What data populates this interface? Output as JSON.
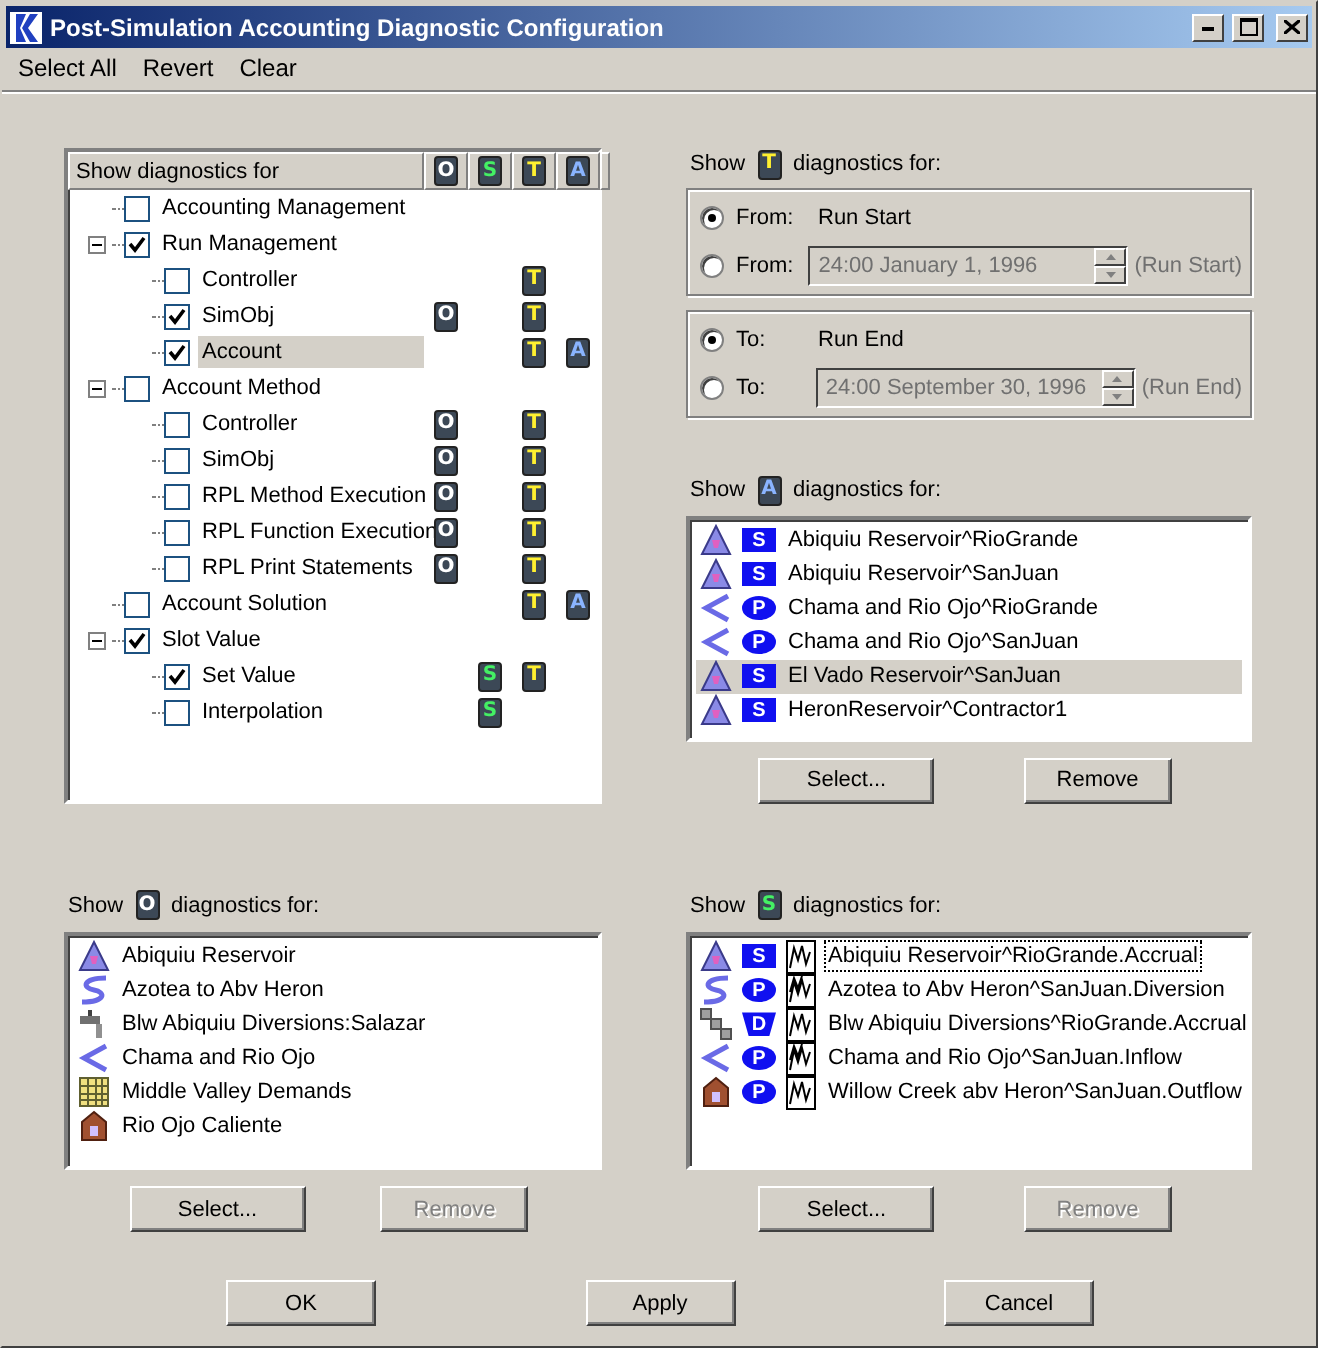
{
  "window": {
    "title": "Post-Simulation Accounting Diagnostic Configuration"
  },
  "menu": [
    {
      "label": "Select All"
    },
    {
      "label": "Revert"
    },
    {
      "label": "Clear"
    }
  ],
  "tree": {
    "heading": "Show diagnostics for",
    "columns": [
      {
        "kind": "object",
        "letter": "O"
      },
      {
        "kind": "slot",
        "letter": "S"
      },
      {
        "kind": "time",
        "letter": "T"
      },
      {
        "kind": "account",
        "letter": "A"
      }
    ],
    "items": [
      {
        "label": "Accounting Management",
        "checked": false,
        "selected": false
      },
      {
        "label": "Run Management",
        "checked": true,
        "selected": false,
        "expanded": true,
        "children": [
          {
            "label": "Controller",
            "checked": false,
            "selected": false,
            "badges": [
              {
                "kind": "time",
                "letter": "T"
              }
            ]
          },
          {
            "label": "SimObj",
            "checked": true,
            "selected": false,
            "badges": [
              {
                "kind": "object",
                "letter": "O"
              },
              {
                "kind": "time",
                "letter": "T"
              }
            ]
          },
          {
            "label": "Account",
            "checked": true,
            "selected": true,
            "badges": [
              {
                "kind": "time",
                "letter": "T"
              },
              {
                "kind": "account",
                "letter": "A"
              }
            ]
          }
        ]
      },
      {
        "label": "Account Method",
        "checked": false,
        "selected": false,
        "expanded": true,
        "children": [
          {
            "label": "Controller",
            "checked": false,
            "selected": false,
            "badges": [
              {
                "kind": "object",
                "letter": "O"
              },
              {
                "kind": "time",
                "letter": "T"
              }
            ]
          },
          {
            "label": "SimObj",
            "checked": false,
            "selected": false,
            "badges": [
              {
                "kind": "object",
                "letter": "O"
              },
              {
                "kind": "time",
                "letter": "T"
              }
            ]
          },
          {
            "label": "RPL Method Execution",
            "checked": false,
            "selected": false,
            "badges": [
              {
                "kind": "object",
                "letter": "O"
              },
              {
                "kind": "time",
                "letter": "T"
              }
            ]
          },
          {
            "label": "RPL Function Execution",
            "checked": false,
            "selected": false,
            "badges": [
              {
                "kind": "object",
                "letter": "O"
              },
              {
                "kind": "time",
                "letter": "T"
              }
            ]
          },
          {
            "label": "RPL Print Statements",
            "checked": false,
            "selected": false,
            "badges": [
              {
                "kind": "object",
                "letter": "O"
              },
              {
                "kind": "time",
                "letter": "T"
              }
            ]
          }
        ]
      },
      {
        "label": "Account Solution",
        "checked": false,
        "selected": false,
        "badges": [
          {
            "kind": "time",
            "letter": "T"
          },
          {
            "kind": "account",
            "letter": "A"
          }
        ]
      },
      {
        "label": "Slot Value",
        "checked": true,
        "selected": false,
        "expanded": true,
        "children": [
          {
            "label": "Set Value",
            "checked": true,
            "selected": false,
            "badges": [
              {
                "kind": "slot",
                "letter": "S"
              },
              {
                "kind": "time",
                "letter": "T"
              }
            ]
          },
          {
            "label": "Interpolation",
            "checked": false,
            "selected": false,
            "badges": [
              {
                "kind": "slot",
                "letter": "S"
              }
            ]
          }
        ]
      }
    ]
  },
  "time": {
    "prefix": "Show",
    "badge": {
      "kind": "time",
      "letter": "T"
    },
    "suffix": "diagnostics for:",
    "groups": [
      {
        "options": [
          {
            "label": "From:",
            "kind": "preset",
            "value": "Run Start",
            "selected": true
          },
          {
            "label": "From:",
            "kind": "date",
            "value": "24:00 January 1, 1996",
            "note": "(Run Start)",
            "selected": false
          }
        ]
      },
      {
        "options": [
          {
            "label": "To:",
            "kind": "preset",
            "value": "Run End",
            "selected": true
          },
          {
            "label": "To:",
            "kind": "date",
            "value": "24:00 September 30, 1996",
            "note": "(Run End)",
            "selected": false
          }
        ]
      }
    ]
  },
  "accounts": {
    "prefix": "Show",
    "badge": {
      "kind": "account",
      "letter": "A"
    },
    "suffix": "diagnostics for:",
    "items": [
      {
        "kind": "reservoir",
        "type": {
          "kind": "square",
          "letter": "S"
        },
        "label": "Abiquiu Reservoir^RioGrande",
        "selected": false
      },
      {
        "kind": "reservoir",
        "type": {
          "kind": "square",
          "letter": "S"
        },
        "label": "Abiquiu Reservoir^SanJuan",
        "selected": false
      },
      {
        "kind": "reach",
        "type": {
          "kind": "oval",
          "letter": "P"
        },
        "label": "Chama and Rio Ojo^RioGrande",
        "selected": false
      },
      {
        "kind": "reach",
        "type": {
          "kind": "oval",
          "letter": "P"
        },
        "label": "Chama and Rio Ojo^SanJuan",
        "selected": false
      },
      {
        "kind": "reservoir",
        "type": {
          "kind": "square",
          "letter": "S"
        },
        "label": "El Vado Reservoir^SanJuan",
        "selected": true
      },
      {
        "kind": "reservoir",
        "type": {
          "kind": "square",
          "letter": "S"
        },
        "label": "HeronReservoir^Contractor1",
        "selected": false
      }
    ],
    "buttons": [
      {
        "label": "Select...",
        "disabled": false
      },
      {
        "label": "Remove",
        "disabled": false
      }
    ]
  },
  "objects": {
    "prefix": "Show",
    "badge": {
      "kind": "object",
      "letter": "O"
    },
    "suffix": "diagnostics for:",
    "items": [
      {
        "kind": "reservoir",
        "label": "Abiquiu Reservoir",
        "selected": false
      },
      {
        "kind": "canal",
        "label": "Azotea to Abv Heron",
        "selected": false
      },
      {
        "kind": "diversion",
        "label": "Blw Abiquiu Diversions:Salazar",
        "selected": false
      },
      {
        "kind": "reach",
        "label": "Chama and Rio Ojo",
        "selected": false
      },
      {
        "kind": "demand",
        "label": "Middle Valley Demands",
        "selected": false
      },
      {
        "kind": "building",
        "label": "Rio Ojo Caliente",
        "selected": false
      }
    ],
    "buttons": [
      {
        "label": "Select...",
        "disabled": false
      },
      {
        "label": "Remove",
        "disabled": true
      }
    ]
  },
  "slots": {
    "prefix": "Show",
    "badge": {
      "kind": "slot",
      "letter": "S"
    },
    "suffix": "diagnostics for:",
    "items": [
      {
        "kind": "reservoir",
        "type": {
          "kind": "square",
          "letter": "S"
        },
        "graph": {
          "kind": "single"
        },
        "label": "Abiquiu Reservoir^RioGrande.Accrual",
        "selected": false,
        "focused": true
      },
      {
        "kind": "canal",
        "type": {
          "kind": "oval",
          "letter": "P"
        },
        "graph": {
          "kind": "double"
        },
        "label": "Azotea to Abv Heron^SanJuan.Diversion",
        "selected": false,
        "focused": false
      },
      {
        "kind": "link",
        "type": {
          "kind": "shield",
          "letter": "D"
        },
        "graph": {
          "kind": "single"
        },
        "label": "Blw Abiquiu Diversions^RioGrande.Accrual",
        "selected": false,
        "focused": false
      },
      {
        "kind": "reach",
        "type": {
          "kind": "oval",
          "letter": "P"
        },
        "graph": {
          "kind": "double"
        },
        "label": "Chama and Rio Ojo^SanJuan.Inflow",
        "selected": false,
        "focused": false
      },
      {
        "kind": "building",
        "type": {
          "kind": "oval",
          "letter": "P"
        },
        "graph": {
          "kind": "single"
        },
        "label": "Willow Creek abv Heron^SanJuan.Outflow",
        "selected": false,
        "focused": false
      }
    ],
    "buttons": [
      {
        "label": "Select...",
        "disabled": false
      },
      {
        "label": "Remove",
        "disabled": true
      }
    ]
  },
  "footer": [
    {
      "label": "OK"
    },
    {
      "label": "Apply"
    },
    {
      "label": "Cancel"
    }
  ]
}
